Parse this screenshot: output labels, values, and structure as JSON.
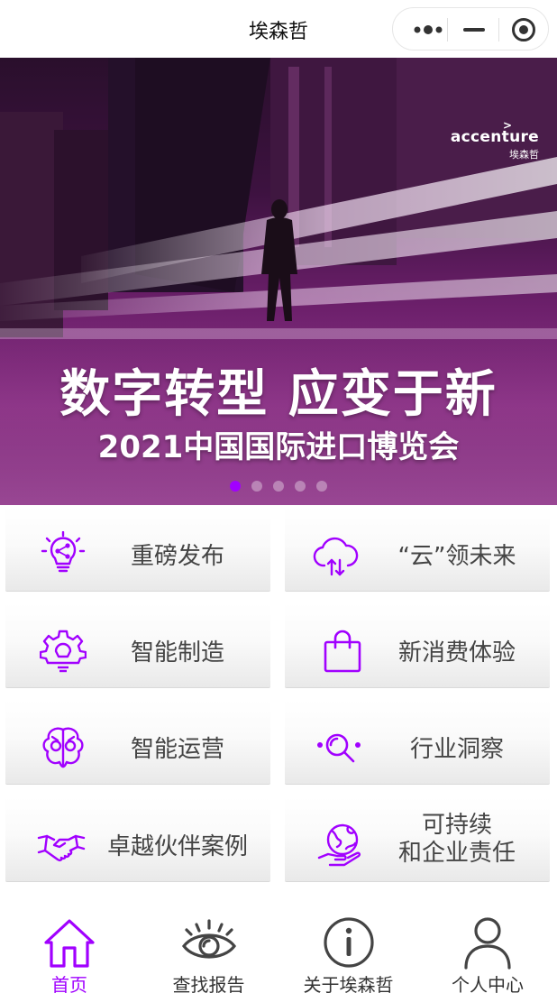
{
  "titlebar": {
    "title": "埃森哲",
    "more_icon": "more-dots-icon",
    "minimize_icon": "minimize-icon",
    "close_icon": "target-close-icon"
  },
  "banner": {
    "logo_brand": "accenture",
    "logo_brand_cn": "埃森哲",
    "headline": "数字转型 应变于新",
    "subline": "2021中国国际进口博览会",
    "slide_count": 5,
    "active_slide": 1
  },
  "grid": {
    "items": [
      {
        "label": "重磅发布",
        "icon": "lightbulb-share-icon"
      },
      {
        "label": "“云”领未来",
        "icon": "cloud-transfer-icon"
      },
      {
        "label": "智能制造",
        "icon": "gear-bulb-icon"
      },
      {
        "label": "新消费体验",
        "icon": "shopping-bag-icon"
      },
      {
        "label": "智能运营",
        "icon": "brain-gear-icon"
      },
      {
        "label": "行业洞察",
        "icon": "magnifier-insight-icon"
      },
      {
        "label": "卓越伙伴案例",
        "icon": "handshake-icon"
      },
      {
        "label_line1": "可持续",
        "label_line2": "和企业责任",
        "icon": "globe-hand-icon"
      }
    ]
  },
  "tabbar": {
    "tabs": [
      {
        "label": "首页",
        "icon": "home-icon",
        "active": true
      },
      {
        "label": "查找报告",
        "icon": "eye-icon",
        "active": false
      },
      {
        "label": "关于埃森哲",
        "icon": "info-icon",
        "active": false
      },
      {
        "label": "个人中心",
        "icon": "user-icon",
        "active": false
      }
    ]
  },
  "colors": {
    "accent": "#a100ff",
    "text": "#444444",
    "banner_dark": "#2a0f2c",
    "banner_purple": "#8e3389"
  }
}
